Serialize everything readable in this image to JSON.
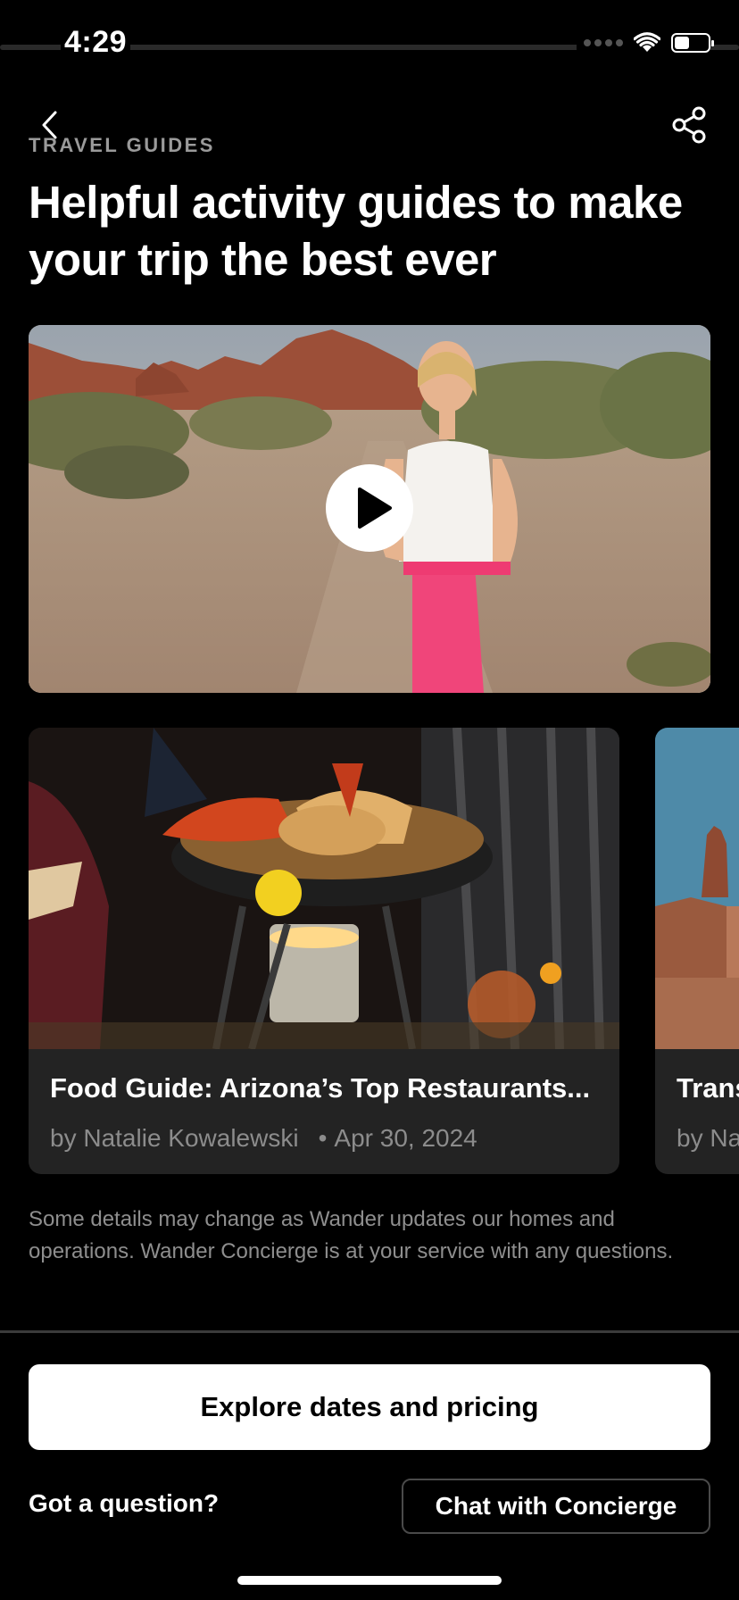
{
  "status_bar": {
    "time": "4:29",
    "battery_level": 0.45
  },
  "header": {
    "back_icon": "chevron-left-icon",
    "share_icon": "share-icon",
    "eyebrow": "TRAVEL GUIDES",
    "title": "Helpful activity guides to make your trip the best ever"
  },
  "hero_video": {
    "play_icon": "play-icon"
  },
  "guides": [
    {
      "title": "Food Guide: Arizona’s Top Restaurants...",
      "author": "by Natalie Kowalewski",
      "date": "Apr 30, 2024"
    },
    {
      "title": "Trans",
      "author": "by Na"
    }
  ],
  "disclaimer": "Some details may change as Wander updates our homes and operations. Wander Concierge is at your service with any questions.",
  "footer": {
    "primary_cta": "Explore dates and pricing",
    "question": "Got a question?",
    "secondary_cta": "Chat with Concierge"
  },
  "colors": {
    "background": "#000000",
    "card": "#232323",
    "muted_text": "#8e8e8e",
    "eyebrow": "#9a9a9a"
  }
}
